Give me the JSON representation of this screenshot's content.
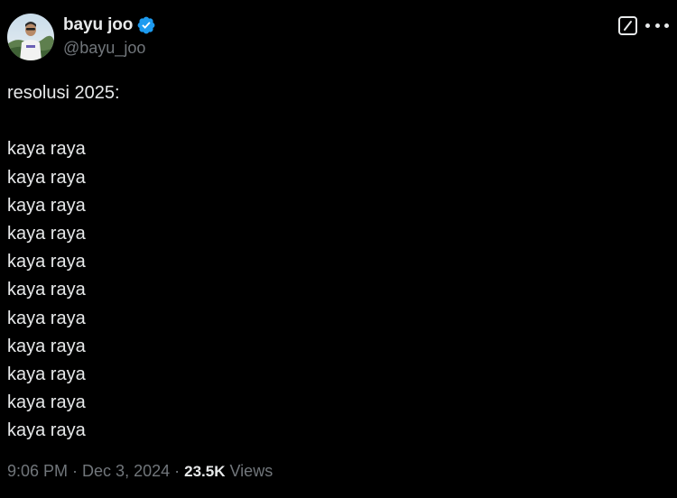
{
  "author": {
    "display_name": "bayu joo",
    "handle": "@bayu_joo",
    "verified": true,
    "avatar_icon": "profile-photo-outdoor"
  },
  "icons": {
    "verified": "verified-badge-icon",
    "grok": "grok-icon",
    "more": "more-icon"
  },
  "colors": {
    "background": "#000000",
    "text_primary": "#e7e9ea",
    "text_secondary": "#71767b",
    "verified_blue": "#1d9bf0"
  },
  "tweet": {
    "lines": [
      "resolusi 2025:",
      "",
      "kaya raya",
      "kaya raya",
      "kaya raya",
      "kaya raya",
      "kaya raya",
      "kaya raya",
      "kaya raya",
      "kaya raya",
      "kaya raya",
      "kaya raya",
      "kaya raya"
    ]
  },
  "meta": {
    "time": "9:06 PM",
    "separator": " · ",
    "date": "Dec 3, 2024",
    "views_count": "23.5K",
    "views_label": " Views"
  }
}
